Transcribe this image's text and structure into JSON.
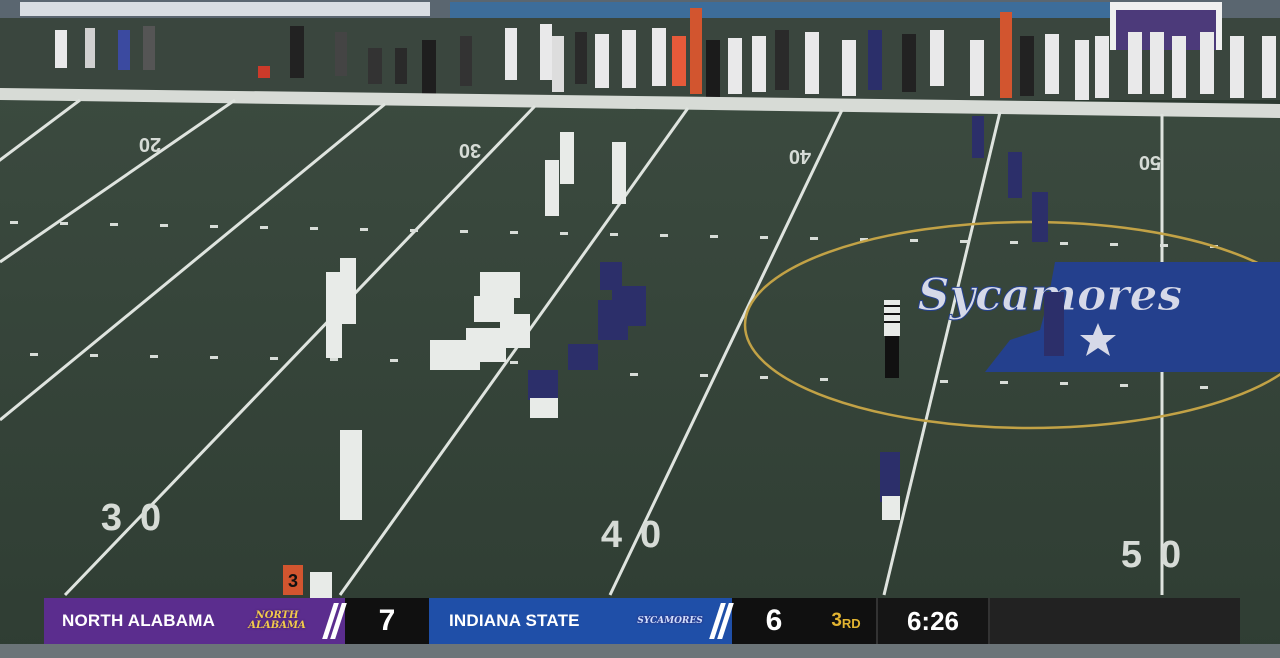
{
  "field": {
    "yard_numbers_far": [
      "20",
      "30",
      "40",
      "50"
    ],
    "yard_numbers_near": [
      "30",
      "40",
      "50"
    ],
    "down_marker": "3",
    "midfield_logo_text": "Sycamores"
  },
  "scorebug": {
    "home_team": "NORTH ALABAMA",
    "home_logo_text": "NORTH ALABAMA",
    "home_score": "7",
    "away_team": "INDIANA STATE",
    "away_logo_text": "SYCAMORES",
    "away_score": "6",
    "quarter_number": "3",
    "quarter_suffix": "RD",
    "clock": "6:26"
  },
  "colors": {
    "home": "#5b2d8e",
    "away": "#1f4fa8",
    "field": "#3a4a3e",
    "quarter_text": "#e2b431"
  }
}
